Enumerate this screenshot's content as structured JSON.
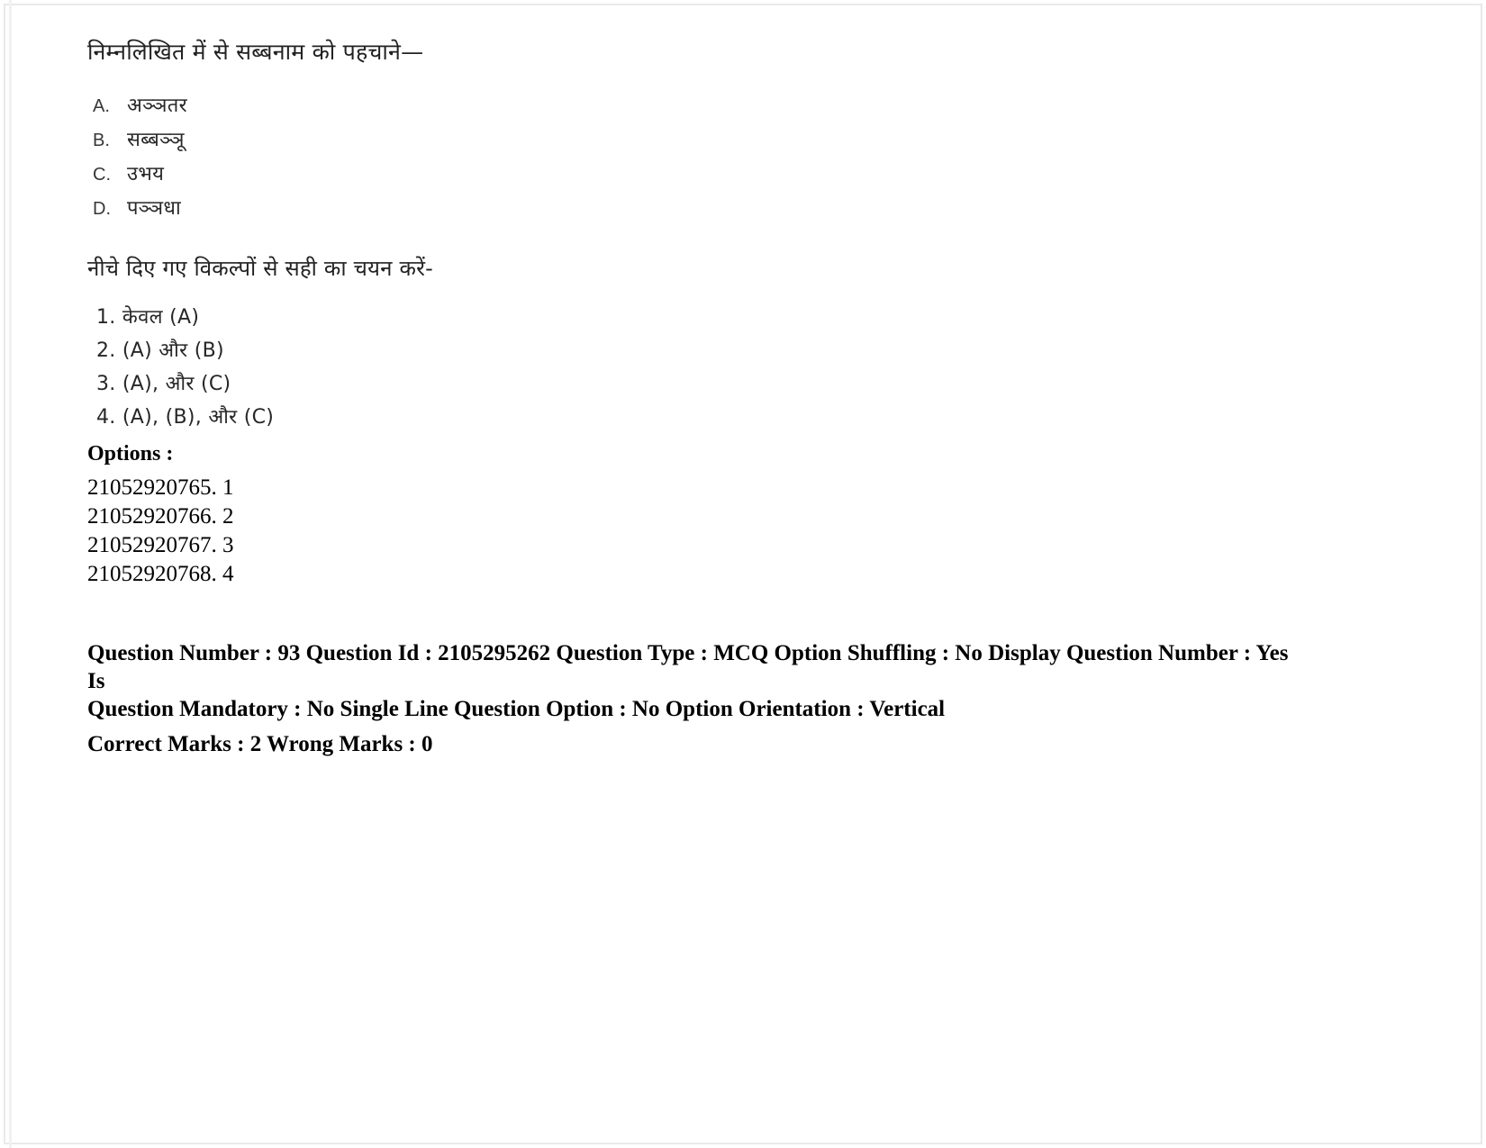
{
  "document": {
    "type": "exam-question-sheet",
    "language": "Hindi"
  },
  "question": {
    "heading": "निम्नलिखित में से सब्बनाम को पहचाने—",
    "statements": [
      {
        "letter": "A.",
        "text": "अञ्ञतर"
      },
      {
        "letter": "B.",
        "text": "सब्बञ्ञू"
      },
      {
        "letter": "C.",
        "text": "उभय"
      },
      {
        "letter": "D.",
        "text": "पञ्ञधा"
      }
    ],
    "instruction": "नीचे दिए गए विकल्पों से सही का चयन करें-",
    "choices": [
      {
        "number": "1.",
        "text": "केवल  (A)",
        "full": "1. केवल  (A)"
      },
      {
        "number": "2.",
        "text": "(A) और (B)",
        "full": "2. (A) और (B)"
      },
      {
        "number": "3.",
        "text": "(A), और (C)",
        "full": "3. (A), और (C)"
      },
      {
        "number": "4.",
        "text": "(A), (B), और (C)",
        "full": "4. (A), (B), और (C)"
      }
    ]
  },
  "options": {
    "label": "Options :",
    "items": [
      {
        "id": "21052920765.",
        "value": "1",
        "full": "21052920765. 1"
      },
      {
        "id": "21052920766.",
        "value": "2",
        "full": "21052920766. 2"
      },
      {
        "id": "21052920767.",
        "value": "3",
        "full": "21052920767. 3"
      },
      {
        "id": "21052920768.",
        "value": "4",
        "full": "21052920768. 4"
      }
    ]
  },
  "metadata": {
    "question_number": "93",
    "question_id": "2105295262",
    "question_type": "MCQ",
    "option_shuffling": "No",
    "display_question_number": "Yes",
    "is_question_mandatory": "No",
    "single_line_question_option": "No",
    "option_orientation": "Vertical",
    "correct_marks": "2",
    "wrong_marks": "0",
    "line1": "Question Number : 93 Question Id : 2105295262 Question Type : MCQ Option Shuffling : No Display Question Number : Yes Is",
    "line2": "Question Mandatory : No Single Line Question Option : No Option Orientation : Vertical",
    "line3": "Correct Marks : 2 Wrong Marks : 0"
  }
}
